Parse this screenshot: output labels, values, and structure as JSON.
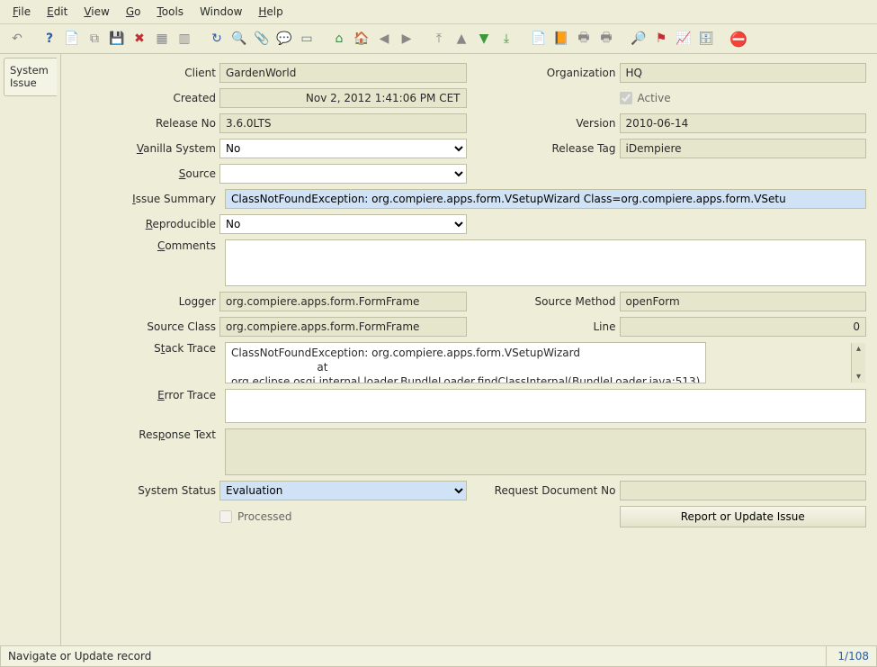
{
  "menu": {
    "file": "File",
    "edit": "Edit",
    "view": "View",
    "go": "Go",
    "tools": "Tools",
    "window": "Window",
    "help": "Help"
  },
  "tab": {
    "system_issue": "System\nIssue"
  },
  "labels": {
    "client": "Client",
    "organization": "Organization",
    "created": "Created",
    "active": "Active",
    "release_no": "Release No",
    "version": "Version",
    "vanilla_system": "Vanilla System",
    "release_tag": "Release Tag",
    "source": "Source",
    "issue_summary": "Issue Summary",
    "reproducible": "Reproducible",
    "comments": "Comments",
    "logger": "Logger",
    "source_method": "Source Method",
    "source_class": "Source Class",
    "line": "Line",
    "stack_trace": "Stack Trace",
    "error_trace": "Error Trace",
    "response_text": "Response Text",
    "system_status": "System Status",
    "request_document_no": "Request Document No",
    "processed": "Processed",
    "report_or_update": "Report or Update Issue"
  },
  "values": {
    "client": "GardenWorld",
    "organization": "HQ",
    "created": "Nov 2, 2012 1:41:06 PM CET",
    "active": true,
    "release_no": "3.6.0LTS",
    "version": "2010-06-14",
    "vanilla_system": "No",
    "release_tag": "iDempiere",
    "source": "",
    "issue_summary": "ClassNotFoundException: org.compiere.apps.form.VSetupWizard Class=org.compiere.apps.form.VSetu",
    "reproducible": "No",
    "comments": "",
    "logger": "org.compiere.apps.form.FormFrame",
    "source_method": "openForm",
    "source_class": "org.compiere.apps.form.FormFrame",
    "line": "0",
    "stack_trace": "ClassNotFoundException: org.compiere.apps.form.VSetupWizard\n                         at\norg.eclipse.osgi.internal.loader.BundleLoader.findClassInternal(BundleLoader.java:513)",
    "error_trace": "",
    "response_text": "",
    "system_status": "Evaluation",
    "request_document_no": "",
    "processed": false
  },
  "status": {
    "message": "Navigate or Update record",
    "position": "1/108"
  },
  "toolbar_icons": {
    "undo": "↶",
    "help": "?",
    "new": "📄",
    "copy": "⧉",
    "save": "💾",
    "delete": "✖",
    "grid": "▦",
    "gridmulti": "▥",
    "refresh": "↻",
    "find": "🔍",
    "attach": "📎",
    "chat": "💬",
    "form": "▭",
    "home": "⌂",
    "house": "🏠",
    "back": "◀",
    "forward": "▶",
    "first": "⤒",
    "up": "▲",
    "down": "▼",
    "last": "⤓",
    "report": "📄",
    "reportb": "📙",
    "print": "🖶",
    "printb": "🖶",
    "zoom": "🔎",
    "flag": "⚑",
    "chart": "📈",
    "archive": "🗄",
    "cancel": "⛔"
  }
}
